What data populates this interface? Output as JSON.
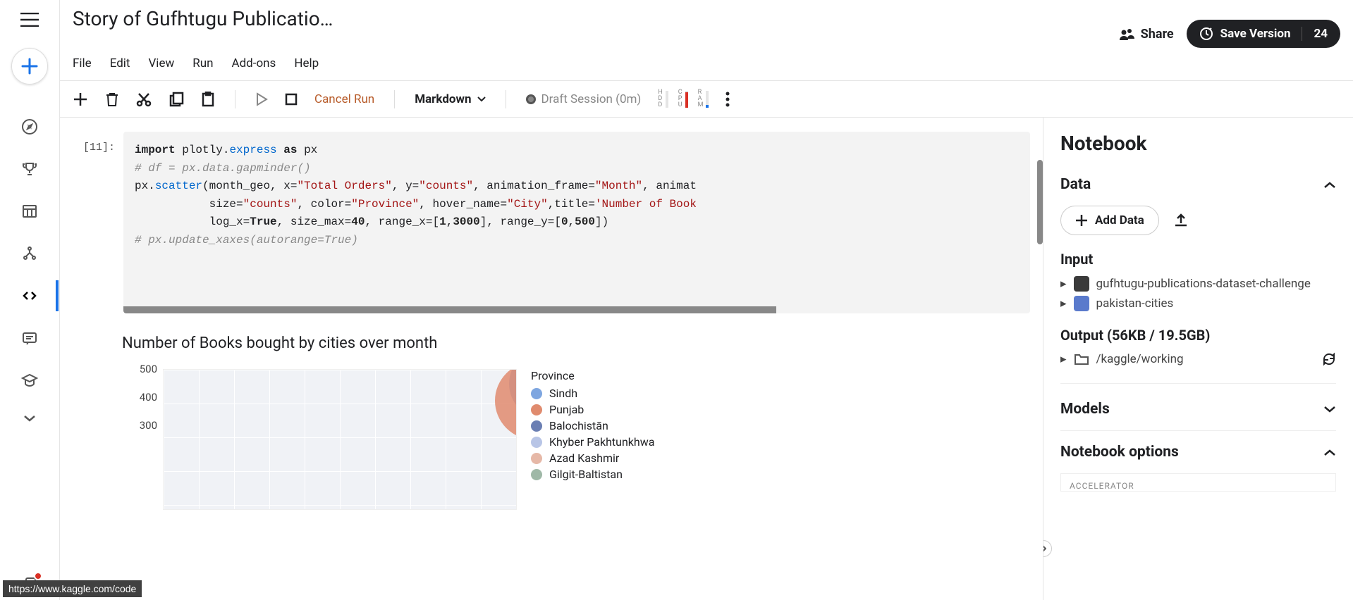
{
  "header": {
    "title": "Story of Gufhtugu Publicatio…",
    "share": "Share",
    "save": "Save Version",
    "version_count": "24",
    "menu": [
      "File",
      "Edit",
      "View",
      "Run",
      "Add-ons",
      "Help"
    ]
  },
  "toolbar": {
    "cancel": "Cancel Run",
    "celltype": "Markdown",
    "session": "Draft Session (0m)",
    "meters": [
      {
        "label": [
          "H",
          "D",
          "D"
        ],
        "fill": 0,
        "color": "#ddd"
      },
      {
        "label": [
          "C",
          "P",
          "U"
        ],
        "fill": 90,
        "color": "#d93025"
      },
      {
        "label": [
          "R",
          "A",
          "M"
        ],
        "fill": 15,
        "color": "#1a73e8"
      }
    ]
  },
  "cell": {
    "prompt": "[11]:",
    "code_lines": [
      [
        {
          "t": "import",
          "c": "k"
        },
        {
          "t": " plotly"
        },
        {
          "t": ".",
          "c": ""
        },
        {
          "t": "express",
          "c": "fn"
        },
        {
          "t": " "
        },
        {
          "t": "as",
          "c": "k"
        },
        {
          "t": " px"
        }
      ],
      [
        {
          "t": "# df = px.data.gapminder()",
          "c": "c"
        }
      ],
      [
        {
          "t": "px."
        },
        {
          "t": "scatter",
          "c": "fn"
        },
        {
          "t": "(month_geo, x="
        },
        {
          "t": "\"Total Orders\"",
          "c": "s"
        },
        {
          "t": ", y="
        },
        {
          "t": "\"counts\"",
          "c": "s"
        },
        {
          "t": ", animation_frame="
        },
        {
          "t": "\"Month\"",
          "c": "s"
        },
        {
          "t": ", animat"
        }
      ],
      [
        {
          "t": "           size="
        },
        {
          "t": "\"counts\"",
          "c": "s"
        },
        {
          "t": ", color="
        },
        {
          "t": "\"Province\"",
          "c": "s"
        },
        {
          "t": ", hover_name="
        },
        {
          "t": "\"City\"",
          "c": "s"
        },
        {
          "t": ",title="
        },
        {
          "t": "'Number of Book",
          "c": "s"
        }
      ],
      [
        {
          "t": "           log_x="
        },
        {
          "t": "True",
          "c": "const"
        },
        {
          "t": ", size_max="
        },
        {
          "t": "40",
          "c": "num"
        },
        {
          "t": ", range_x=["
        },
        {
          "t": "1",
          "c": "num"
        },
        {
          "t": ","
        },
        {
          "t": "3000",
          "c": "num"
        },
        {
          "t": "], range_y=["
        },
        {
          "t": "0",
          "c": "num"
        },
        {
          "t": ","
        },
        {
          "t": "500",
          "c": "num"
        },
        {
          "t": "])"
        }
      ],
      [
        {
          "t": "# px.update_xaxes(autorange=True)",
          "c": "c"
        }
      ]
    ]
  },
  "chart_data": {
    "type": "scatter",
    "title": "Number of Books bought by cities over month",
    "ylabel": "",
    "ylim": [
      0,
      500
    ],
    "yticks": [
      300,
      400,
      500
    ],
    "legend_title": "Province",
    "series": [
      {
        "name": "Sindh",
        "color": "#7ea6e0"
      },
      {
        "name": "Punjab",
        "color": "#e08b6e"
      },
      {
        "name": "Balochistān",
        "color": "#6b7fb3"
      },
      {
        "name": "Khyber Pakhtunkhwa",
        "color": "#b8c5e6"
      },
      {
        "name": "Azad Kashmir",
        "color": "#e6b8a7"
      },
      {
        "name": "Gilgit-Baltistan",
        "color": "#9fb8a7"
      }
    ],
    "bubbles": [
      {
        "series": "Sindh",
        "x_pct": 96,
        "y": 450,
        "size": 100
      },
      {
        "series": "Punjab",
        "x_pct": 93,
        "y": 390,
        "size": 110
      }
    ]
  },
  "right": {
    "title": "Notebook",
    "data_hdr": "Data",
    "add_data": "Add Data",
    "input_hdr": "Input",
    "inputs": [
      {
        "caret": "▸",
        "name": "gufhtugu-publications-dataset-challenge",
        "thumb": "#3a3a3a"
      },
      {
        "caret": "▸",
        "name": "pakistan-cities",
        "thumb": "#5a7acc"
      }
    ],
    "output_hdr": "Output (56KB / 19.5GB)",
    "output_path": "/kaggle/working",
    "models_hdr": "Models",
    "options_hdr": "Notebook options",
    "accelerator": "ACCELERATOR"
  },
  "status_url": "https://www.kaggle.com/code"
}
